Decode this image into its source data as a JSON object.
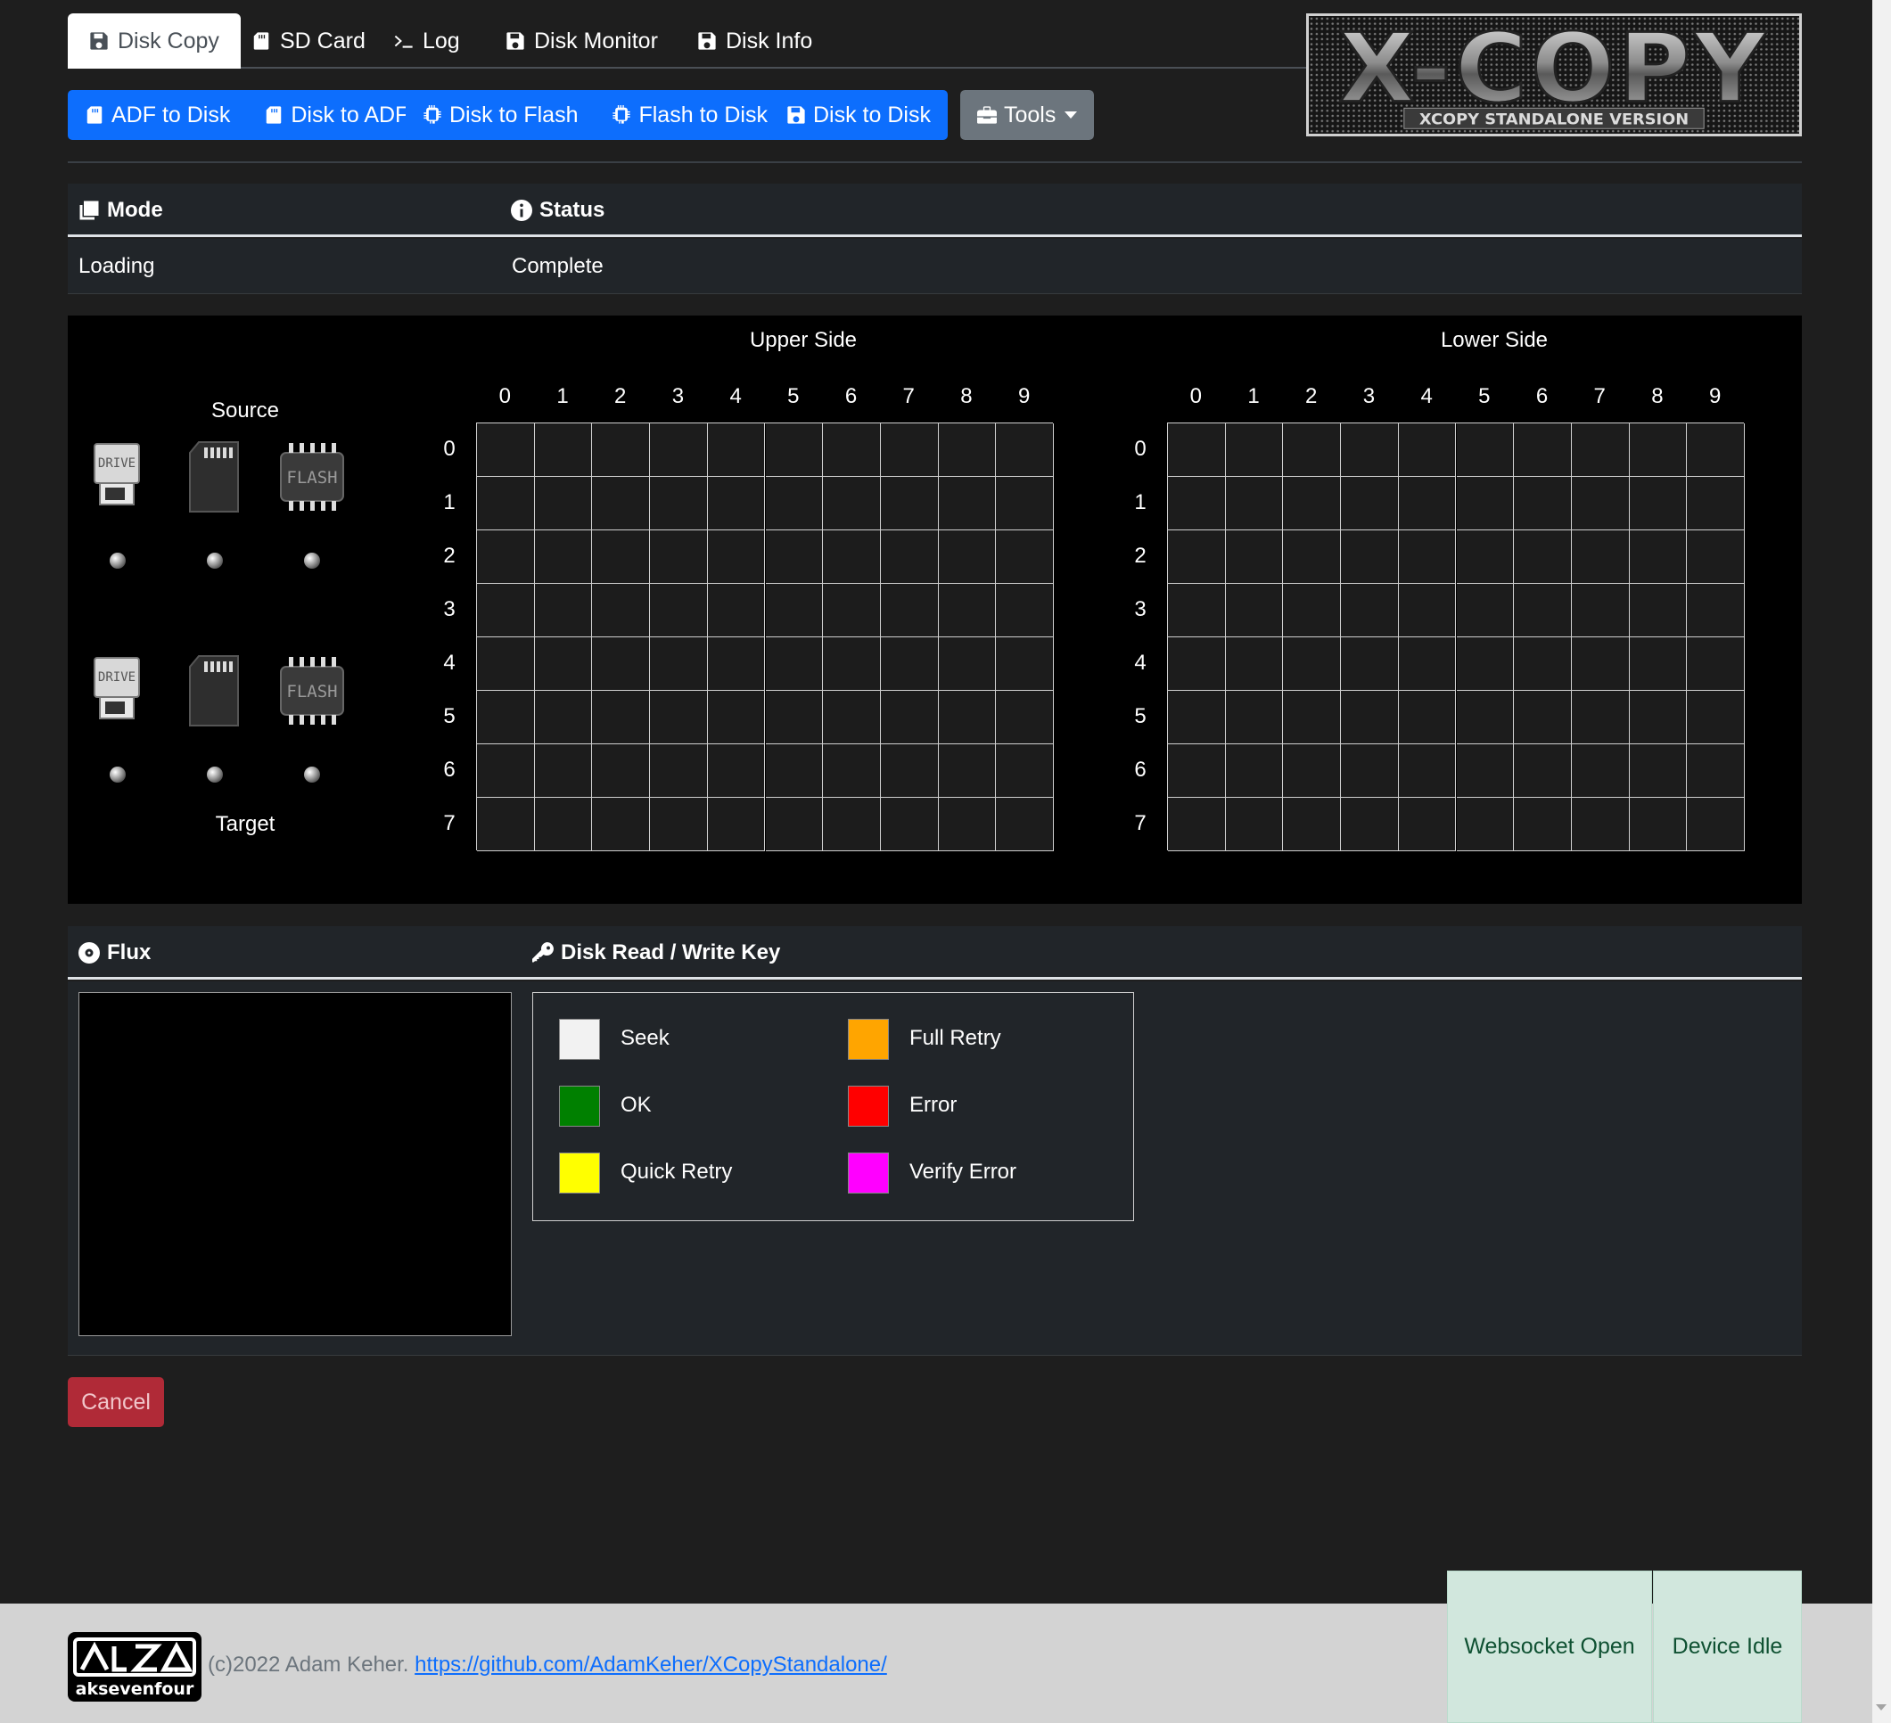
{
  "tabs": [
    {
      "label": "Disk Copy",
      "icon": "floppy-icon",
      "active": true
    },
    {
      "label": "SD Card",
      "icon": "sd-card-icon"
    },
    {
      "label": "Log",
      "icon": "terminal-icon"
    },
    {
      "label": "Disk Monitor",
      "icon": "floppy-icon"
    },
    {
      "label": "Disk Info",
      "icon": "floppy-icon"
    }
  ],
  "logo": {
    "title": "X-COPY",
    "subtitle": "XCOPY STANDALONE VERSION"
  },
  "buttons": {
    "adf_to_disk": "ADF to Disk",
    "disk_to_adf": "Disk to ADF",
    "disk_to_flash": "Disk to Flash",
    "flash_to_disk": "Flash to Disk",
    "disk_to_disk": "Disk to Disk",
    "tools": "Tools"
  },
  "status_table": {
    "mode_header": "Mode",
    "status_header": "Status",
    "mode_value": "Loading",
    "status_value": "Complete"
  },
  "disk_panel": {
    "source_label": "Source",
    "target_label": "Target",
    "upper_side_label": "Upper Side",
    "lower_side_label": "Lower Side",
    "col_labels": [
      "0",
      "1",
      "2",
      "3",
      "4",
      "5",
      "6",
      "7",
      "8",
      "9"
    ],
    "row_labels": [
      "0",
      "1",
      "2",
      "3",
      "4",
      "5",
      "6",
      "7"
    ],
    "device_labels": {
      "drive": "DRIVE",
      "flash": "FLASH"
    }
  },
  "flux_header": "Flux",
  "key_header": "Disk Read / Write Key",
  "key_items": [
    {
      "label": "Seek",
      "color": "#f2f2f2"
    },
    {
      "label": "OK",
      "color": "#008000"
    },
    {
      "label": "Quick Retry",
      "color": "#ffff00"
    },
    {
      "label": "Full Retry",
      "color": "#ffa500"
    },
    {
      "label": "Error",
      "color": "#ff0000"
    },
    {
      "label": "Verify Error",
      "color": "#ff00ff"
    }
  ],
  "cancel_label": "Cancel",
  "footer": {
    "brand": "aksevenfour",
    "copyright": "(c)2022 Adam Keher. ",
    "link": "https://github.com/AdamKeher/XCopyStandalone/",
    "websocket_status": "Websocket Open",
    "device_status": "Device Idle"
  }
}
